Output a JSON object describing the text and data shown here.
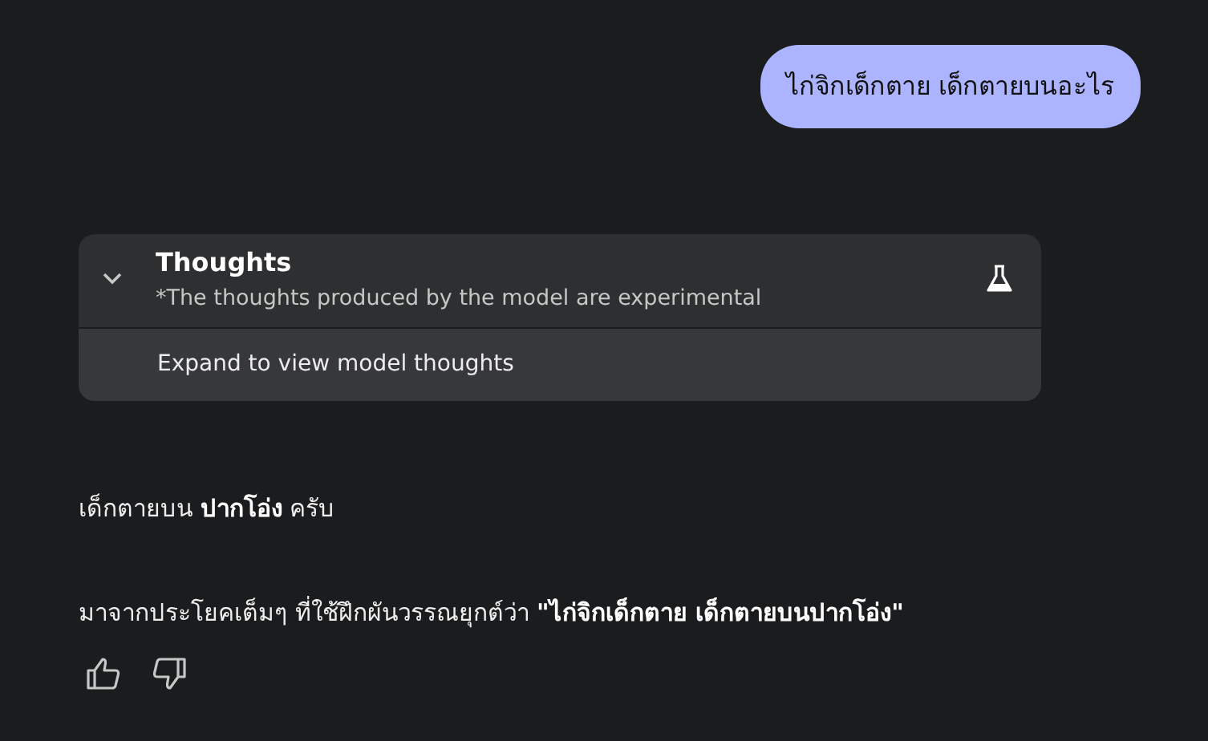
{
  "user_message": {
    "text": "ไก่จิกเด็กตาย เด็กตายบนอะไร"
  },
  "thoughts": {
    "title": "Thoughts",
    "subtitle": "*The thoughts produced by the model are experimental",
    "expanded": false,
    "expand_label": "Expand to view model thoughts"
  },
  "response": {
    "paragraphs": [
      "เด็กตายบน **ปากโอ่ง** ครับ",
      "มาจากประโยคเต็มๆ ที่ใช้ฝึกผันวรรณยุกต์ว่า **\"ไก่จิกเด็กตาย เด็กตายบนปากโอ่ง\"**"
    ]
  }
}
